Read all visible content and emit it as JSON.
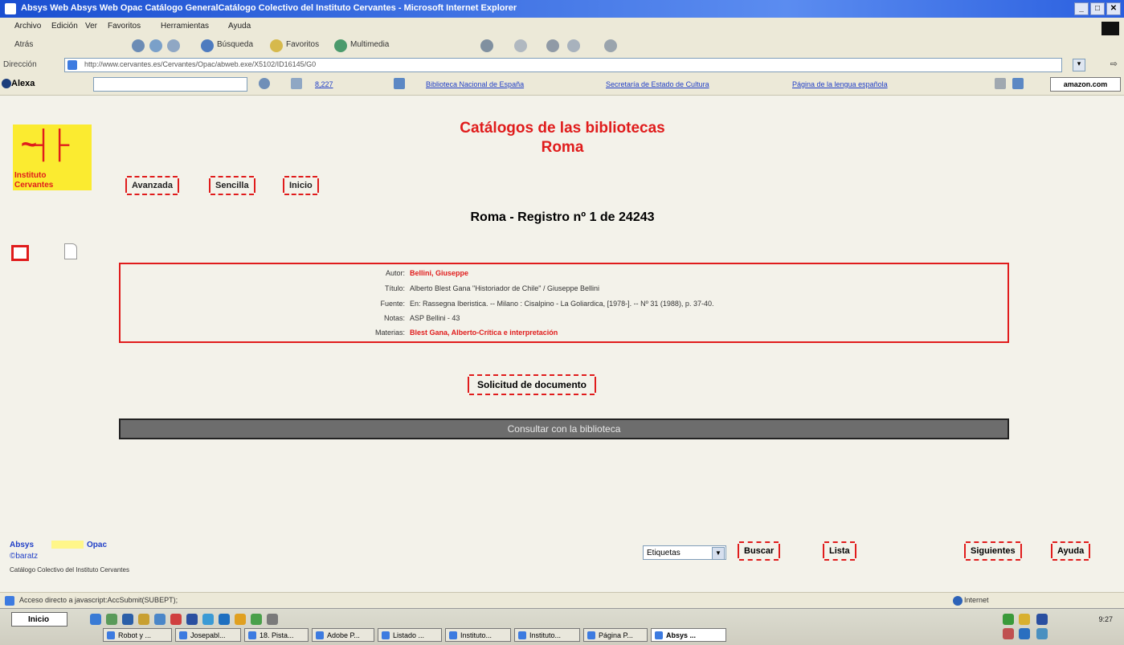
{
  "window": {
    "title": "Absys Web Absys Web Opac Catálogo GeneralCatálogo Colectivo del Instituto Cervantes - Microsoft Internet Explorer",
    "controls": [
      "_",
      "□",
      "✕"
    ]
  },
  "menu": [
    "Archivo",
    "Edición",
    "Ver",
    "Favoritos",
    "Herramientas",
    "Ayuda"
  ],
  "toolbar": {
    "back": "Atrás",
    "search": "Búsqueda",
    "favorites": "Favoritos",
    "multimedia": "Multimedia"
  },
  "address": {
    "label": "Dirección",
    "url": "http://www.cervantes.es/Cervantes/Opac/abweb.exe/X5102/ID16145/G0",
    "go": "Ir"
  },
  "alexa_bar": {
    "label": "Alexa",
    "count": "8,227",
    "links": [
      "Biblioteca Nacional de España",
      "Secretaría de Estado de Cultura",
      "Página de la lengua española"
    ],
    "amazon": "amazon.com"
  },
  "page": {
    "heading_line1": "Catálogos de las bibliotecas",
    "heading_line2": "Roma",
    "logo_line1": "Instituto",
    "logo_line2": "Cervantes",
    "nav": [
      "Avanzada",
      "Sencilla",
      "Inicio"
    ],
    "record_title": "Roma - Registro nº 1 de 24243",
    "record": [
      {
        "key": "Autor:",
        "value": "Bellini, Giuseppe",
        "link": true
      },
      {
        "key": "Título:",
        "value": "Alberto Blest Gana \"Historiador de Chile\" / Giuseppe Bellini",
        "link": false
      },
      {
        "key": "Fuente:",
        "value": "En: Rassegna Iberistica. -- Milano : Cisalpino - La Goliardica, [1978-]. -- Nº 31 (1988), p. 37-40.",
        "link": false
      },
      {
        "key": "Notas:",
        "value": "ASP Bellini - 43",
        "link": false
      },
      {
        "key": "Materias:",
        "value": "Blest Gana, Alberto-Crítica e interpretación",
        "link": true
      }
    ],
    "request_button": "Solicitud de documento",
    "consult_bar": "Consultar con la biblioteca",
    "footer": {
      "absys": "Absys",
      "opac": "Opac",
      "baratz": "©baratz",
      "catalog": "Catálogo Colectivo del Instituto Cervantes"
    },
    "format_select": "Etiquetas",
    "buttons": {
      "search": "Buscar",
      "list": "Lista",
      "next": "Siguientes",
      "help": "Ayuda"
    }
  },
  "status": {
    "text": "Acceso directo a javascript:AccSubmit(SUBEPT);",
    "zone": "Internet"
  },
  "taskbar": {
    "start": "Inicio",
    "clock": "9:27",
    "tasks": [
      "Robot y ...",
      "Josepabl...",
      "18. Pista...",
      "Adobe P...",
      "Listado ...",
      "Instituto...",
      "Instituto...",
      "Página P...",
      "Absys ..."
    ]
  }
}
